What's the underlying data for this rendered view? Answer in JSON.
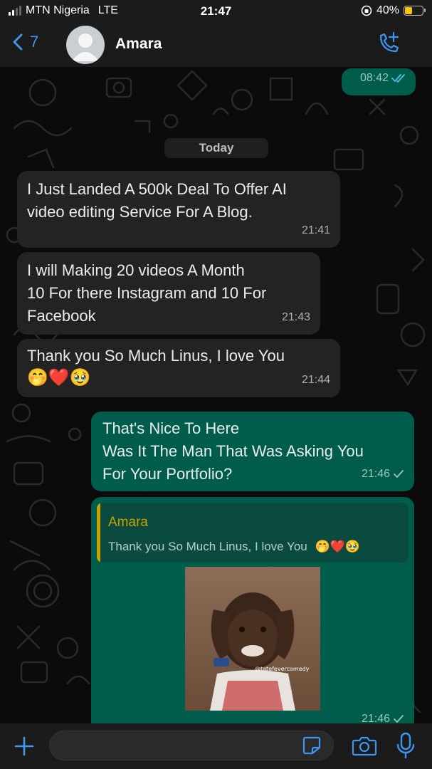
{
  "status_bar": {
    "carrier": "MTN Nigeria",
    "network": "LTE",
    "time": "21:47",
    "battery": "40%",
    "battery_level": 0.4
  },
  "header": {
    "back_count": "7",
    "contact_name": "Amara"
  },
  "messages": [
    {
      "direction": "out",
      "text": "",
      "time": "08:42",
      "status": "read-double-tick"
    },
    {
      "direction": "day",
      "text": "Today"
    },
    {
      "direction": "in",
      "text": "I Just Landed A 500k Deal To Offer AI\nvideo editing Service For A Blog.",
      "time": "21:41"
    },
    {
      "direction": "in",
      "text": "I will Making 20 videos A Month\n10 For there Instagram and 10 For\nFacebook",
      "time": "21:43"
    },
    {
      "direction": "in",
      "text": "Thank you So Much Linus, I love You",
      "emoji": "🤭❤️🥹",
      "time": "21:44"
    },
    {
      "direction": "out",
      "text": "That's Nice To Here\nWas It The Man That Was Asking You\nFor Your Portfolio?",
      "time": "21:46",
      "status": "sent-tick"
    },
    {
      "direction": "out",
      "quote_name": "Amara",
      "quote_text": "Thank you So Much Linus, I love You",
      "quote_emoji": "🤭❤️🥹",
      "media": "photo",
      "media_watermark": "@tatefevercomedy",
      "time": "21:46",
      "status": "sent-tick"
    }
  ],
  "icons": {
    "back": "chevron-left-icon",
    "call": "phone-plus-icon",
    "plus": "plus-icon",
    "sticker": "sticker-icon",
    "camera": "camera-icon",
    "mic": "microphone-icon"
  },
  "colors": {
    "accent": "#3b97f0",
    "outgoing_bubble": "#005c4b",
    "incoming_bubble": "#232323",
    "quote_name": "#c9a100"
  }
}
